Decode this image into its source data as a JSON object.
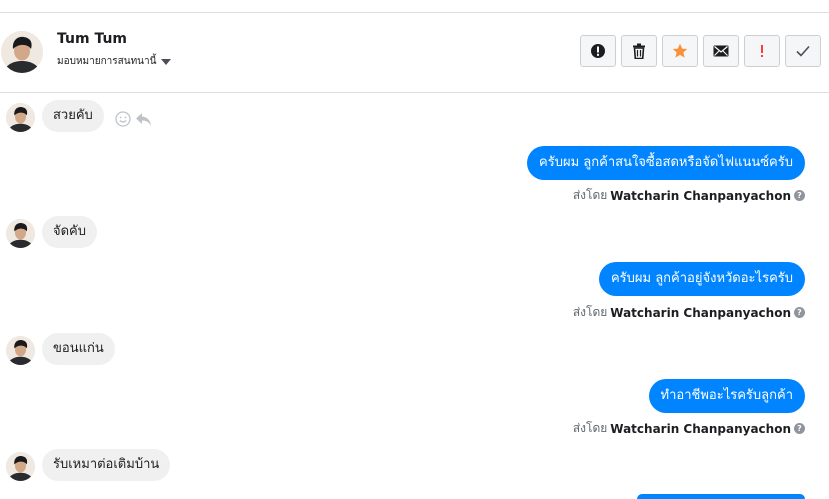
{
  "header": {
    "name": "Tum Tum",
    "assign_label": "มอบหมายการสนทนานี้"
  },
  "toolbar": {
    "icons": [
      "alert-circle-icon",
      "trash-icon",
      "star-icon",
      "envelope-icon",
      "exclamation-icon",
      "check-icon"
    ],
    "star_color": "#f7923b",
    "alert_color": "#fa3e3e"
  },
  "messages": [
    {
      "direction": "in",
      "text": "สวยคับ"
    },
    {
      "direction": "out",
      "text": "ครับผม ลูกค้าสนใจซื้อสดหรือจัดไฟแนนซ์ครับ",
      "sent_by_label": "ส่งโดย",
      "sender": "Watcharin Chanpanyachon"
    },
    {
      "direction": "in",
      "text": "จัดคับ"
    },
    {
      "direction": "out",
      "text": "ครับผม ลูกค้าอยู่จังหวัดอะไรครับ",
      "sent_by_label": "ส่งโดย",
      "sender": "Watcharin Chanpanyachon"
    },
    {
      "direction": "in",
      "text": "ขอนแก่น"
    },
    {
      "direction": "out",
      "text": "ทำอาชีพอะไรครับลูกค้า",
      "sent_by_label": "ส่งโดย",
      "sender": "Watcharin Chanpanyachon"
    },
    {
      "direction": "in",
      "text": "รับเหมาต่อเติมบ้าน"
    }
  ],
  "colors": {
    "outgoing_bubble": "#0084ff",
    "incoming_bubble": "#f1f0f0"
  }
}
